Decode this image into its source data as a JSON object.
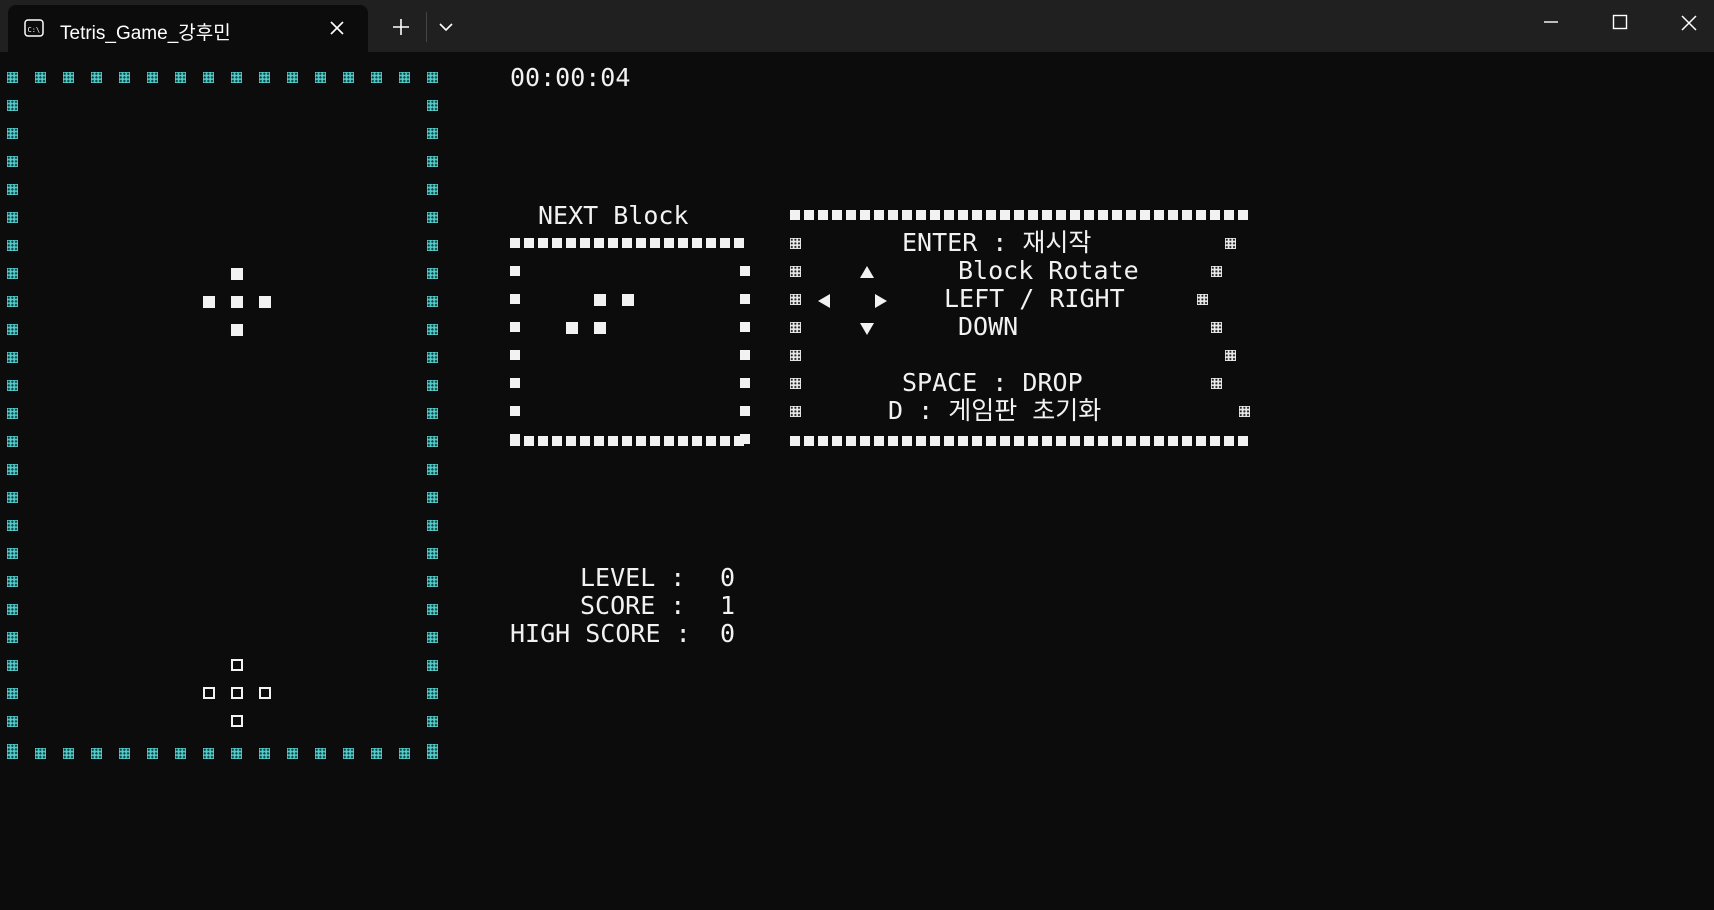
{
  "window": {
    "tab_title": "Tetris_Game_강후민"
  },
  "timer": "00:00:04",
  "next_block": {
    "title": "NEXT Block"
  },
  "help": {
    "enter": "ENTER : 재시작",
    "rotate": "Block Rotate",
    "left_right": "LEFT / RIGHT",
    "down": "DOWN",
    "space": "SPACE : DROP",
    "reset": "D : 게임판 초기화"
  },
  "stats": {
    "level_label": "LEVEL :",
    "level_value": "0",
    "score_label": "SCORE :",
    "score_value": "1",
    "high_label": "HIGH SCORE :",
    "high_value": "0"
  },
  "icons": {
    "console": "console-icon",
    "close_tab": "close-icon",
    "new_tab": "plus-icon",
    "dropdown": "chevron-down-icon",
    "minimize": "minimize-icon",
    "maximize": "maximize-icon",
    "close_window": "close-icon"
  },
  "colors": {
    "border_cell": "#57c9c8",
    "background": "#0c0c0c",
    "titlebar": "#202020"
  }
}
